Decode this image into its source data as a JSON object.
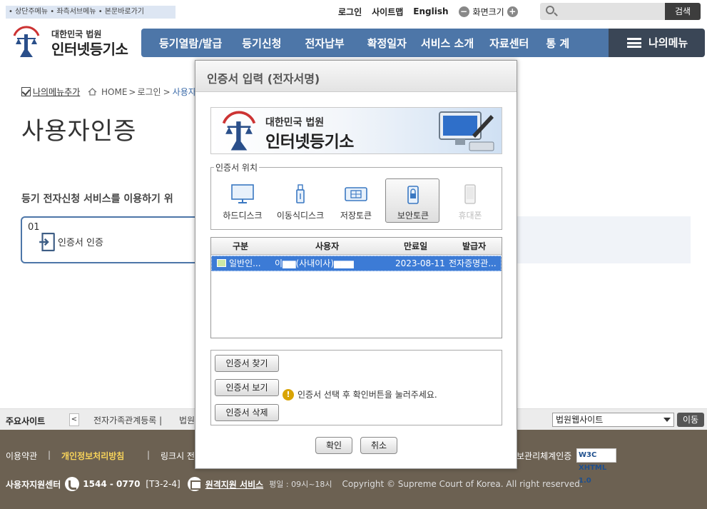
{
  "skip_links": "• 상단주메뉴 • 좌측서브메뉴 • 본문바로가기",
  "top": {
    "login": "로그인",
    "sitemap": "사이트맵",
    "english": "English",
    "font_size": "화면크기",
    "search_button": "검색",
    "minus": "−",
    "plus": "+"
  },
  "logo": {
    "sub": "대한민국 법원",
    "main": "인터넷등기소"
  },
  "nav": {
    "items": [
      "등기열람/발급",
      "등기신청",
      "전자납부",
      "확정일자",
      "서비스 소개",
      "자료센터",
      "통 계"
    ],
    "mymenu": "나의메뉴"
  },
  "breadcrumb": {
    "mymenu_add": "나의메뉴추가",
    "home": "HOME",
    "sep": ">",
    "login": "로그인",
    "current": "사용자인"
  },
  "page_title": "사용자인증",
  "intro": "등기 전자신청 서비스를 이용하기 위",
  "step": {
    "num": "01",
    "label": "인증서 인증"
  },
  "site_bar": {
    "label": "주요사이트",
    "prev": "<",
    "link1": "전자가족관계등록 |",
    "link2": "법원",
    "select_value": "법원웹사이트",
    "go": "이동"
  },
  "footer": {
    "terms": "이용약관",
    "privacy": "개인정보처리방침",
    "link_refusal": "링크시 전제",
    "cert": "보관리체계인증",
    "sep": "|",
    "support_label": "사용자지원센터",
    "phone": "1544 - 0770",
    "phone_code": "[T3-2-4]",
    "remote": "원격지원 서비스",
    "hours": "평일 : 09시~18시",
    "copyright": "Copyright © Supreme Court of Korea. All right reserved.",
    "w3c": "W3C XHTML 1.0"
  },
  "dialog": {
    "title": "인증서 입력 (전자서명)",
    "banner_sub": "대한민국 법원",
    "banner_main": "인터넷등기소",
    "location_legend": "인증서 위치",
    "devices": [
      {
        "label": "하드디스크",
        "icon": "monitor-icon",
        "selected": false,
        "disabled": false
      },
      {
        "label": "이동식디스크",
        "icon": "usb-icon",
        "selected": false,
        "disabled": false
      },
      {
        "label": "저장토큰",
        "icon": "token-icon",
        "selected": false,
        "disabled": false
      },
      {
        "label": "보안토큰",
        "icon": "secure-token-icon",
        "selected": true,
        "disabled": false
      },
      {
        "label": "휴대폰",
        "icon": "phone-icon",
        "selected": false,
        "disabled": true
      }
    ],
    "table": {
      "headers": [
        "구분",
        "사용자",
        "만료일",
        "발급자"
      ],
      "rows": [
        {
          "type": "일반인...",
          "user": "이▆▆(사내이사)▆▆▆",
          "expires": "2023-08-11",
          "issuer": "전자증명관..."
        }
      ]
    },
    "buttons": {
      "find": "인증서 찾기",
      "view": "인증서 보기",
      "delete": "인증서 삭제"
    },
    "message": "인증서 선택 후 확인버튼을 눌러주세요.",
    "warn_symbol": "!",
    "ok": "확인",
    "cancel": "취소"
  },
  "colors": {
    "nav_blue": "#4d76a8",
    "selection_blue": "#3c7bd6",
    "footer_brown": "#6c6152",
    "privacy_yellow": "#f7d35a"
  }
}
